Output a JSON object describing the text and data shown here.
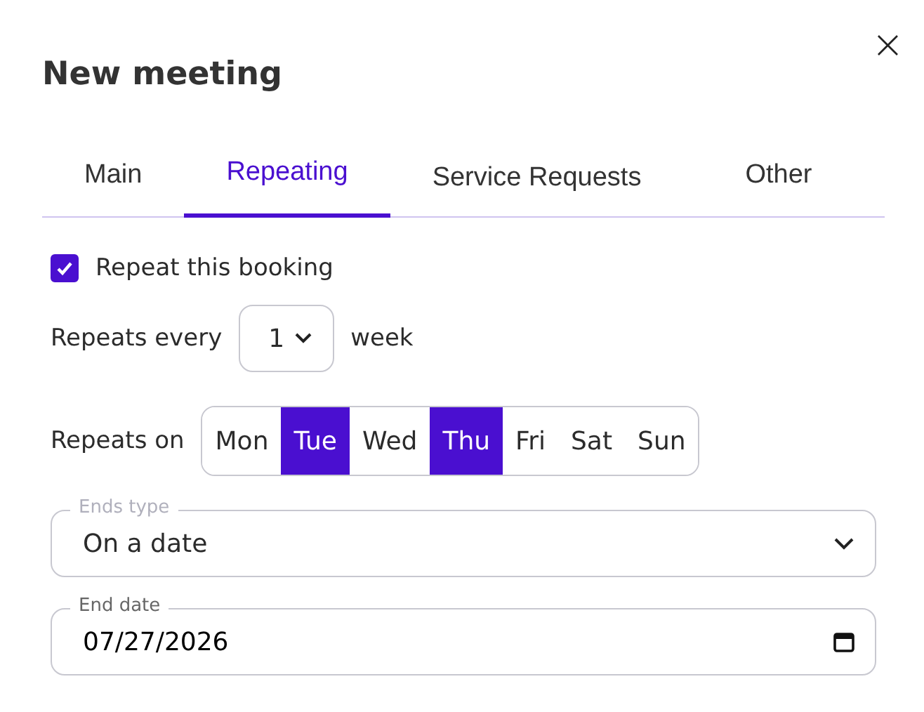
{
  "dialog": {
    "title": "New meeting",
    "close": "×"
  },
  "tabs": [
    {
      "label": "Main",
      "selected": false
    },
    {
      "label": "Repeating",
      "selected": true
    },
    {
      "label": "Service Requests",
      "selected": false
    },
    {
      "label": "Other",
      "selected": false
    }
  ],
  "repeat": {
    "label": "Repeat this booking",
    "checked": true
  },
  "interval": {
    "label": "Repeats every",
    "value": "1",
    "unit": "week"
  },
  "days": {
    "label": "Repeats on",
    "items": [
      {
        "label": "Mon",
        "selected": false
      },
      {
        "label": "Tue",
        "selected": true
      },
      {
        "label": "Wed",
        "selected": false
      },
      {
        "label": "Thu",
        "selected": true
      },
      {
        "label": "Fri",
        "selected": false
      },
      {
        "label": "Sat",
        "selected": false
      },
      {
        "label": "Sun",
        "selected": false
      }
    ]
  },
  "ends_type": {
    "label": "Ends type",
    "value": "On a date"
  },
  "end_date": {
    "label": "End date",
    "value": "07/27/2026"
  }
}
